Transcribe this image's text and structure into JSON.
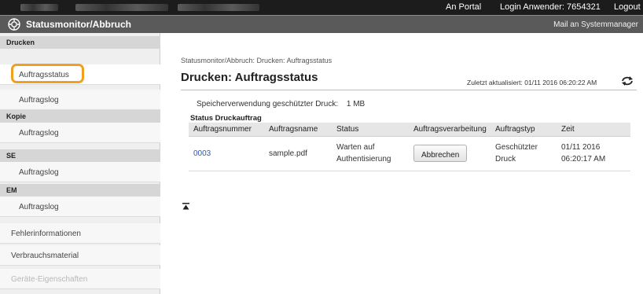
{
  "topbar": {
    "portal_label": "An Portal",
    "login_label": "Login Anwender:  7654321",
    "logout_label": "Logout"
  },
  "header": {
    "title": "Statusmonitor/Abbruch",
    "mail_link": "Mail an Systemmanager"
  },
  "sidebar": {
    "sections": [
      {
        "label": "Drucken",
        "items": [
          "Auftragsstatus",
          "Auftragslog"
        ]
      },
      {
        "label": "Kopie",
        "items": [
          "Auftragslog"
        ]
      },
      {
        "label": "SE",
        "items": [
          "Auftragslog"
        ]
      },
      {
        "label": "EM",
        "items": [
          "Auftragslog"
        ]
      }
    ],
    "extra_items": [
      "Fehlerinformationen",
      "Verbrauchsmaterial",
      "Geräte-Eigenschaften"
    ],
    "selected": "Auftragsstatus"
  },
  "main": {
    "breadcrumb": "Statusmonitor/Abbruch: Drucken: Auftragsstatus",
    "title": "Drucken: Auftragsstatus",
    "updated": "Zuletzt aktualisiert: 01/11 2016 06:20:22 AM",
    "storage_label": "Speicherverwendung geschützter Druck:",
    "storage_value": "1 MB",
    "section_title": "Status Druckauftrag",
    "columns": [
      "Auftragsnummer",
      "Auftragsname",
      "Status",
      "Auftragsverarbeitung",
      "Auftragstyp",
      "Zeit"
    ],
    "rows": [
      {
        "number": "0003",
        "name": "sample.pdf",
        "status_line1": "Warten auf",
        "status_line2": "Authentisierung",
        "action": "Abbrechen",
        "type_line1": "Geschützter",
        "type_line2": "Druck",
        "time_line1": "01/11 2016",
        "time_line2": "06:20:17 AM"
      }
    ]
  },
  "colors": {
    "topbar": "#1c1c1c",
    "header": "#5a5a5a",
    "highlight": "#f0a020",
    "link": "#3355aa"
  },
  "icons": {
    "logo": "settings-gear-icon",
    "refresh": "refresh-icon",
    "scroll_top": "scroll-to-top-icon"
  }
}
